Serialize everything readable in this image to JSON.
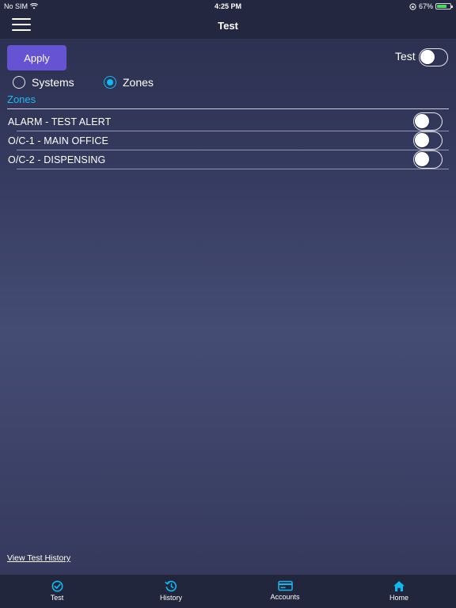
{
  "status_bar": {
    "carrier": "No SIM",
    "time": "4:25 PM",
    "battery": "67%",
    "battery_level": 0.67
  },
  "header": {
    "title": "Test"
  },
  "controls": {
    "apply_label": "Apply",
    "test_toggle_label": "Test",
    "test_toggle_on": false
  },
  "mode": {
    "options": [
      {
        "label": "Systems",
        "selected": false
      },
      {
        "label": "Zones",
        "selected": true
      }
    ]
  },
  "zones": {
    "title": "Zones",
    "items": [
      {
        "label": "ALARM - TEST ALERT",
        "enabled": false
      },
      {
        "label": "O/C-1 - MAIN OFFICE",
        "enabled": false
      },
      {
        "label": "O/C-2 - DISPENSING",
        "enabled": false
      }
    ]
  },
  "footer": {
    "history_link": "View Test History"
  },
  "tabs": [
    {
      "label": "Test",
      "icon": "check-circle-icon"
    },
    {
      "label": "History",
      "icon": "history-icon"
    },
    {
      "label": "Accounts",
      "icon": "card-icon"
    },
    {
      "label": "Home",
      "icon": "home-icon"
    }
  ],
  "colors": {
    "accent": "#12b9f0",
    "apply_button": "#6553d4",
    "bar_background": "#23273f",
    "battery": "#4cd964"
  }
}
